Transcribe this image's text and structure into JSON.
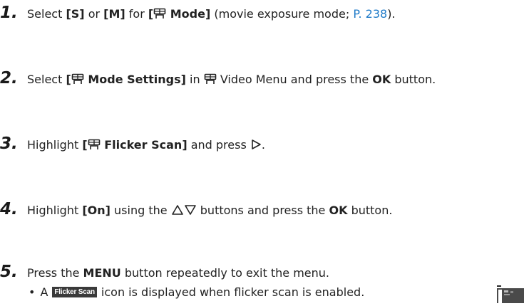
{
  "steps": [
    {
      "number": "1.",
      "parts": {
        "a": "Select ",
        "b": "[S]",
        "c": " or ",
        "d": "[M]",
        "e": " for ",
        "f": "[",
        "g": " Mode]",
        "h": " (movie exposure mode; ",
        "link": "P. 238",
        "i": ")."
      }
    },
    {
      "number": "2.",
      "parts": {
        "a": "Select ",
        "b": "[",
        "c": " Mode Settings]",
        "d": " in ",
        "e": " Video Menu and press the ",
        "f": "OK",
        "g": " button."
      }
    },
    {
      "number": "3.",
      "parts": {
        "a": "Highlight ",
        "b": "[",
        "c": " Flicker Scan]",
        "d": " and press ",
        "e": "."
      }
    },
    {
      "number": "4.",
      "parts": {
        "a": "Highlight ",
        "b": "[On]",
        "c": " using the ",
        "d": " buttons and press the ",
        "e": "OK",
        "f": " button."
      }
    },
    {
      "number": "5.",
      "parts": {
        "a": "Press the ",
        "b": "MENU",
        "c": " button repeatedly to exit the menu."
      }
    }
  ],
  "bullet": {
    "marker": "•",
    "a": "A",
    "badge": "Flicker Scan",
    "b": "icon is displayed when flicker scan is enabled."
  },
  "colors": {
    "link": "#1e7ac8",
    "text": "#222222",
    "badge_bg": "#3a3a3a"
  }
}
